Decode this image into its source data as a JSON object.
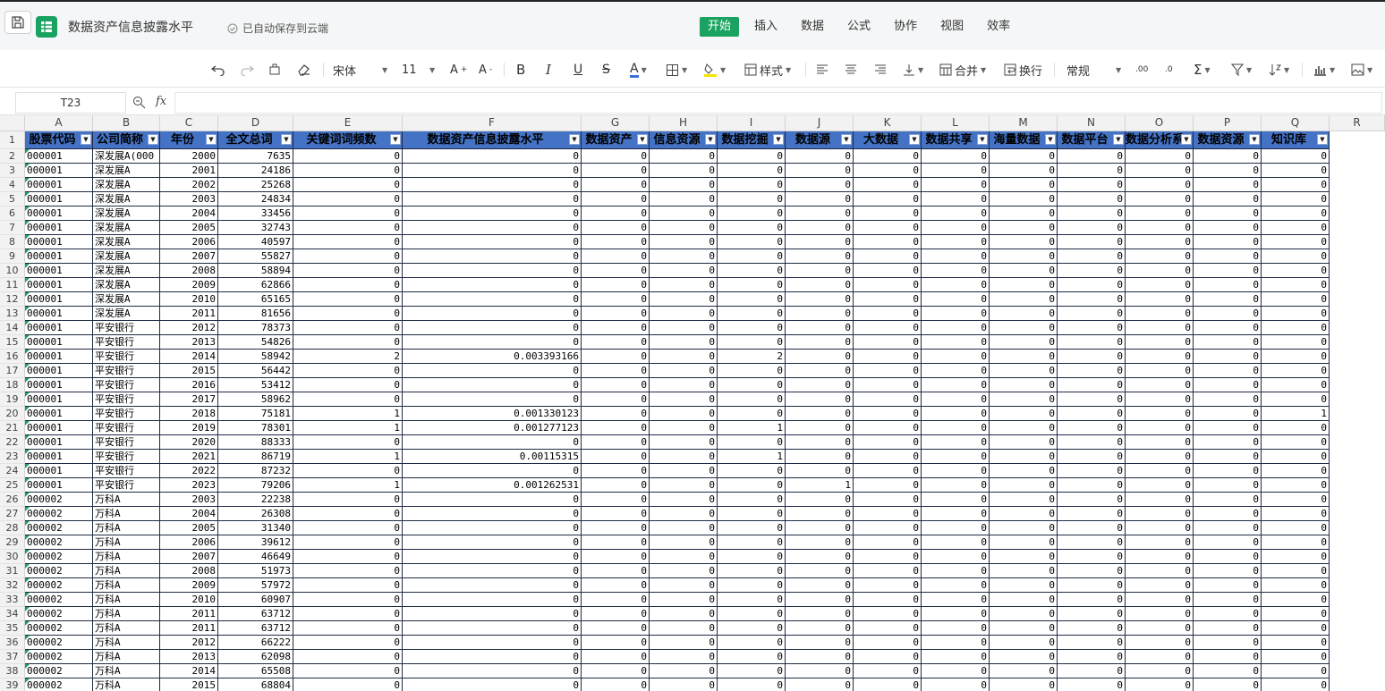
{
  "app": {
    "title": "数据资产信息披露水平",
    "save_state": "已自动保存到云端",
    "accent": "#1aa260"
  },
  "menus": [
    {
      "label": "开始",
      "active": true
    },
    {
      "label": "插入"
    },
    {
      "label": "数据"
    },
    {
      "label": "公式"
    },
    {
      "label": "协作"
    },
    {
      "label": "视图"
    },
    {
      "label": "效率"
    }
  ],
  "toolbar": {
    "font": "宋体",
    "size": "11",
    "style_label": "样式",
    "merge_label": "合并",
    "wrap_label": "换行",
    "format": "常规",
    "icons": [
      "undo-icon",
      "redo-icon",
      "format-painter-icon",
      "eraser-icon",
      "increase-font-icon",
      "decrease-font-icon",
      "bold-icon",
      "italic-icon",
      "underline-icon",
      "strikethrough-icon",
      "font-color-icon",
      "border-icon",
      "fill-color-icon",
      "align-left-icon",
      "align-center-icon",
      "align-right-icon",
      "vertical-align-icon",
      "increase-decimal-icon",
      "decrease-decimal-icon",
      "sum-icon",
      "filter-icon",
      "sort-icon",
      "chart-icon",
      "image-icon"
    ]
  },
  "formula_bar": {
    "cell_ref": "T23",
    "fx": "fx",
    "formula": ""
  },
  "sheet": {
    "columns": [
      "A",
      "B",
      "C",
      "D",
      "E",
      "F",
      "G",
      "H",
      "I",
      "J",
      "K",
      "L",
      "M",
      "N",
      "O",
      "P",
      "Q",
      "R"
    ],
    "header_row": [
      "股票代码",
      "公司简称",
      "年份",
      "全文总词",
      "关键词词频数",
      "数据资产信息披露水平",
      "数据资产",
      "信息资源",
      "数据挖掘",
      "数据源",
      "大数据",
      "数据共享",
      "海量数据",
      "数据平台",
      "数据分析系",
      "数据资源",
      "知识库"
    ],
    "rows": [
      [
        "000001",
        "深发展A(000",
        2000,
        7635,
        0,
        "0",
        0,
        0,
        0,
        0,
        0,
        0,
        0,
        0,
        0,
        0,
        0
      ],
      [
        "000001",
        "深发展A",
        2001,
        24186,
        0,
        "0",
        0,
        0,
        0,
        0,
        0,
        0,
        0,
        0,
        0,
        0,
        0
      ],
      [
        "000001",
        "深发展A",
        2002,
        25268,
        0,
        "0",
        0,
        0,
        0,
        0,
        0,
        0,
        0,
        0,
        0,
        0,
        0
      ],
      [
        "000001",
        "深发展A",
        2003,
        24834,
        0,
        "0",
        0,
        0,
        0,
        0,
        0,
        0,
        0,
        0,
        0,
        0,
        0
      ],
      [
        "000001",
        "深发展A",
        2004,
        33456,
        0,
        "0",
        0,
        0,
        0,
        0,
        0,
        0,
        0,
        0,
        0,
        0,
        0
      ],
      [
        "000001",
        "深发展A",
        2005,
        32743,
        0,
        "0",
        0,
        0,
        0,
        0,
        0,
        0,
        0,
        0,
        0,
        0,
        0
      ],
      [
        "000001",
        "深发展A",
        2006,
        40597,
        0,
        "0",
        0,
        0,
        0,
        0,
        0,
        0,
        0,
        0,
        0,
        0,
        0
      ],
      [
        "000001",
        "深发展A",
        2007,
        55827,
        0,
        "0",
        0,
        0,
        0,
        0,
        0,
        0,
        0,
        0,
        0,
        0,
        0
      ],
      [
        "000001",
        "深发展A",
        2008,
        58894,
        0,
        "0",
        0,
        0,
        0,
        0,
        0,
        0,
        0,
        0,
        0,
        0,
        0
      ],
      [
        "000001",
        "深发展A",
        2009,
        62866,
        0,
        "0",
        0,
        0,
        0,
        0,
        0,
        0,
        0,
        0,
        0,
        0,
        0
      ],
      [
        "000001",
        "深发展A",
        2010,
        65165,
        0,
        "0",
        0,
        0,
        0,
        0,
        0,
        0,
        0,
        0,
        0,
        0,
        0
      ],
      [
        "000001",
        "深发展A",
        2011,
        81656,
        0,
        "0",
        0,
        0,
        0,
        0,
        0,
        0,
        0,
        0,
        0,
        0,
        0
      ],
      [
        "000001",
        "平安银行",
        2012,
        78373,
        0,
        "0",
        0,
        0,
        0,
        0,
        0,
        0,
        0,
        0,
        0,
        0,
        0
      ],
      [
        "000001",
        "平安银行",
        2013,
        54826,
        0,
        "0",
        0,
        0,
        0,
        0,
        0,
        0,
        0,
        0,
        0,
        0,
        0
      ],
      [
        "000001",
        "平安银行",
        2014,
        58942,
        2,
        "0.003393166",
        0,
        0,
        2,
        0,
        0,
        0,
        0,
        0,
        0,
        0,
        0
      ],
      [
        "000001",
        "平安银行",
        2015,
        56442,
        0,
        "0",
        0,
        0,
        0,
        0,
        0,
        0,
        0,
        0,
        0,
        0,
        0
      ],
      [
        "000001",
        "平安银行",
        2016,
        53412,
        0,
        "0",
        0,
        0,
        0,
        0,
        0,
        0,
        0,
        0,
        0,
        0,
        0
      ],
      [
        "000001",
        "平安银行",
        2017,
        58962,
        0,
        "0",
        0,
        0,
        0,
        0,
        0,
        0,
        0,
        0,
        0,
        0,
        0
      ],
      [
        "000001",
        "平安银行",
        2018,
        75181,
        1,
        "0.001330123",
        0,
        0,
        0,
        0,
        0,
        0,
        0,
        0,
        0,
        0,
        1
      ],
      [
        "000001",
        "平安银行",
        2019,
        78301,
        1,
        "0.001277123",
        0,
        0,
        1,
        0,
        0,
        0,
        0,
        0,
        0,
        0,
        0
      ],
      [
        "000001",
        "平安银行",
        2020,
        88333,
        0,
        "0",
        0,
        0,
        0,
        0,
        0,
        0,
        0,
        0,
        0,
        0,
        0
      ],
      [
        "000001",
        "平安银行",
        2021,
        86719,
        1,
        "0.00115315",
        0,
        0,
        1,
        0,
        0,
        0,
        0,
        0,
        0,
        0,
        0
      ],
      [
        "000001",
        "平安银行",
        2022,
        87232,
        0,
        "0",
        0,
        0,
        0,
        0,
        0,
        0,
        0,
        0,
        0,
        0,
        0
      ],
      [
        "000001",
        "平安银行",
        2023,
        79206,
        1,
        "0.001262531",
        0,
        0,
        0,
        1,
        0,
        0,
        0,
        0,
        0,
        0,
        0
      ],
      [
        "000002",
        "万科A",
        2003,
        22238,
        0,
        "0",
        0,
        0,
        0,
        0,
        0,
        0,
        0,
        0,
        0,
        0,
        0
      ],
      [
        "000002",
        "万科A",
        2004,
        26308,
        0,
        "0",
        0,
        0,
        0,
        0,
        0,
        0,
        0,
        0,
        0,
        0,
        0
      ],
      [
        "000002",
        "万科A",
        2005,
        31340,
        0,
        "0",
        0,
        0,
        0,
        0,
        0,
        0,
        0,
        0,
        0,
        0,
        0
      ],
      [
        "000002",
        "万科A",
        2006,
        39612,
        0,
        "0",
        0,
        0,
        0,
        0,
        0,
        0,
        0,
        0,
        0,
        0,
        0
      ],
      [
        "000002",
        "万科A",
        2007,
        46649,
        0,
        "0",
        0,
        0,
        0,
        0,
        0,
        0,
        0,
        0,
        0,
        0,
        0
      ],
      [
        "000002",
        "万科A",
        2008,
        51973,
        0,
        "0",
        0,
        0,
        0,
        0,
        0,
        0,
        0,
        0,
        0,
        0,
        0
      ],
      [
        "000002",
        "万科A",
        2009,
        57972,
        0,
        "0",
        0,
        0,
        0,
        0,
        0,
        0,
        0,
        0,
        0,
        0,
        0
      ],
      [
        "000002",
        "万科A",
        2010,
        60907,
        0,
        "0",
        0,
        0,
        0,
        0,
        0,
        0,
        0,
        0,
        0,
        0,
        0
      ],
      [
        "000002",
        "万科A",
        2011,
        63712,
        0,
        "0",
        0,
        0,
        0,
        0,
        0,
        0,
        0,
        0,
        0,
        0,
        0
      ],
      [
        "000002",
        "万科A",
        2011,
        63712,
        0,
        "0",
        0,
        0,
        0,
        0,
        0,
        0,
        0,
        0,
        0,
        0,
        0
      ],
      [
        "000002",
        "万科A",
        2012,
        66222,
        0,
        "0",
        0,
        0,
        0,
        0,
        0,
        0,
        0,
        0,
        0,
        0,
        0
      ],
      [
        "000002",
        "万科A",
        2013,
        62098,
        0,
        "0",
        0,
        0,
        0,
        0,
        0,
        0,
        0,
        0,
        0,
        0,
        0
      ],
      [
        "000002",
        "万科A",
        2014,
        65508,
        0,
        "0",
        0,
        0,
        0,
        0,
        0,
        0,
        0,
        0,
        0,
        0,
        0
      ],
      [
        "000002",
        "万科A",
        2015,
        68804,
        0,
        "0",
        0,
        0,
        0,
        0,
        0,
        0,
        0,
        0,
        0,
        0,
        0
      ]
    ]
  }
}
